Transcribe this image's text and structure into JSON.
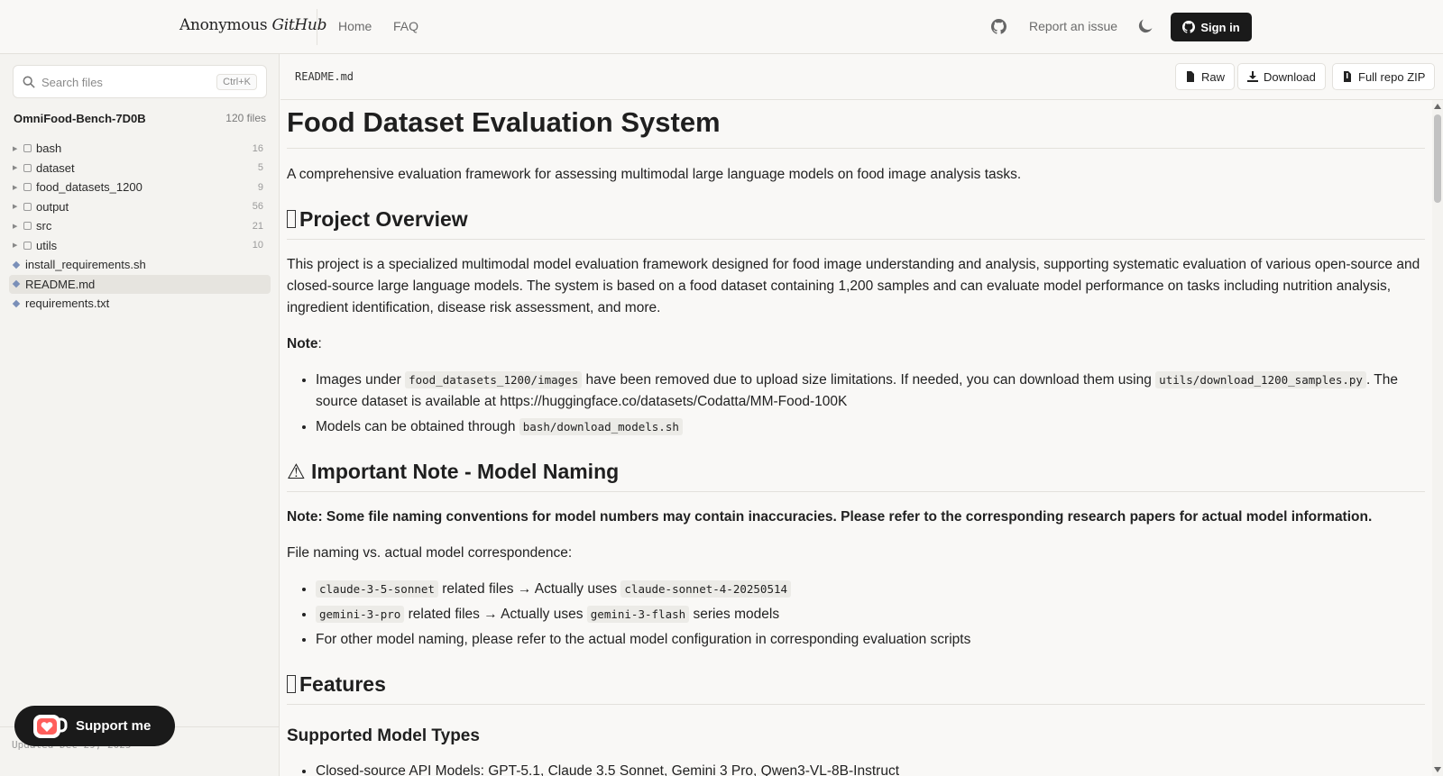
{
  "header": {
    "brand_prefix": "Anonymous",
    "brand_italic": "GitHub",
    "nav": [
      {
        "label": "Home"
      },
      {
        "label": "FAQ"
      }
    ],
    "report_label": "Report an issue",
    "signin_label": "Sign in"
  },
  "sidebar": {
    "search_placeholder": "Search files",
    "search_shortcut": "Ctrl+K",
    "repo_name": "OmniFood-Bench-7D0B",
    "repo_count": "120 files",
    "folders": [
      {
        "name": "bash",
        "count": "16"
      },
      {
        "name": "dataset",
        "count": "5"
      },
      {
        "name": "food_datasets_1200",
        "count": "9"
      },
      {
        "name": "output",
        "count": "56"
      },
      {
        "name": "src",
        "count": "21"
      },
      {
        "name": "utils",
        "count": "10"
      }
    ],
    "files": [
      {
        "name": "install_requirements.sh"
      },
      {
        "name": "README.md"
      },
      {
        "name": "requirements.txt"
      }
    ],
    "updated": "Updated Dec 29, 2025",
    "support_label": "Support me"
  },
  "filebar": {
    "filename": "README.md",
    "raw_label": "Raw",
    "download_label": "Download",
    "zip_label": "Full repo ZIP"
  },
  "readme": {
    "title": "Food Dataset Evaluation System",
    "intro": "A comprehensive evaluation framework for assessing multimodal large language models on food image analysis tasks.",
    "h_overview": "Project Overview",
    "overview_text": "This project is a specialized multimodal model evaluation framework designed for food image understanding and analysis, supporting systematic evaluation of various open-source and closed-source large language models. The system is based on a food dataset containing 1,200 samples and can evaluate model performance on tasks including nutrition analysis, ingredient identification, disease risk assessment, and more.",
    "note_label": "Note",
    "note_colon": ":",
    "note1_pre": "Images under ",
    "note1_code1": "food_datasets_1200/images",
    "note1_mid": " have been removed due to upload size limitations. If needed, you can download them using ",
    "note1_code2": "utils/download_1200_samples.py",
    "note1_post": ". The source dataset is available at https://huggingface.co/datasets/Codatta/MM-Food-100K",
    "note2_pre": "Models can be obtained through ",
    "note2_code": "bash/download_models.sh",
    "h_naming": "⚠ Important Note - Model Naming",
    "naming_bold": "Note: Some file naming conventions for model numbers may contain inaccuracies. Please refer to the corresponding research papers for actual model information.",
    "naming_intro": "File naming vs. actual model correspondence:",
    "map1_code1": "claude-3-5-sonnet",
    "map1_mid": " related files → Actually uses ",
    "map1_code2": "claude-sonnet-4-20250514",
    "map2_code1": "gemini-3-pro",
    "map2_mid": " related files → Actually uses ",
    "map2_code2": "gemini-3-flash",
    "map2_post": " series models",
    "map3": "For other model naming, please refer to the actual model configuration in corresponding evaluation scripts",
    "h_features": "Features",
    "h_supported": "Supported Model Types",
    "supported_partial": "Closed-source API Models: GPT-5.1, Claude 3.5 Sonnet, Gemini 3 Pro, Qwen3-VL-8B-Instruct"
  },
  "colors": {
    "accent": "#1a1a1a",
    "border": "#e3e1dc",
    "background": "#f9f8f6"
  }
}
